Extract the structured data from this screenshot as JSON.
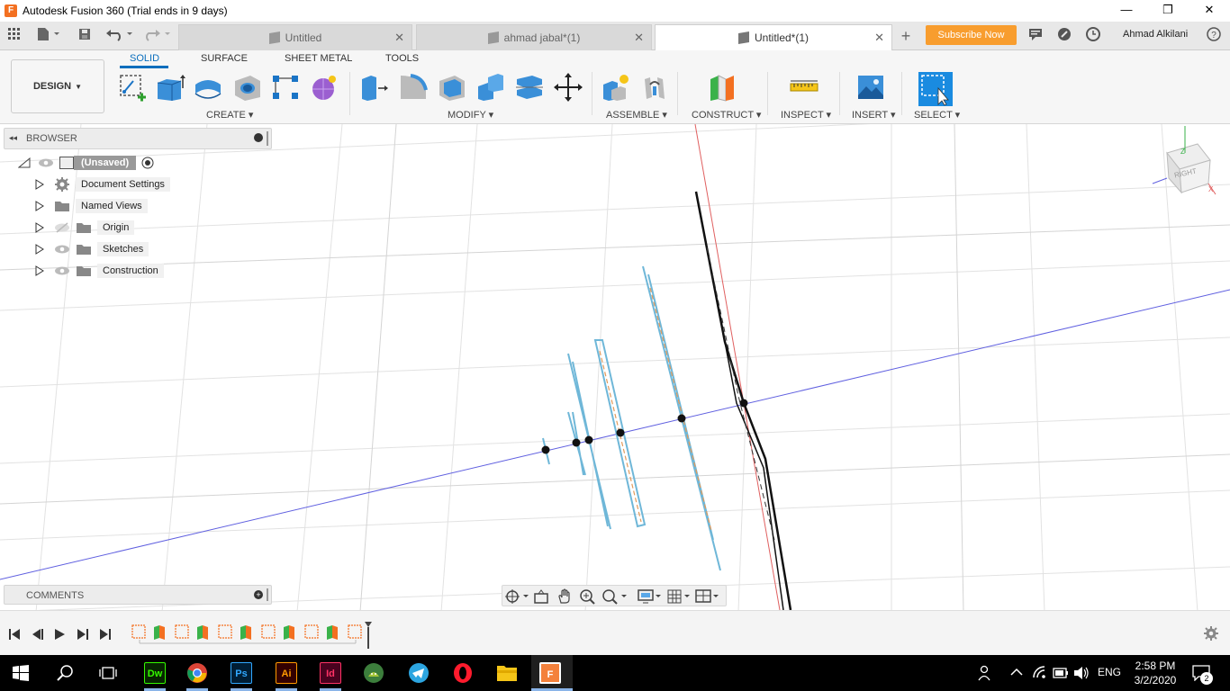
{
  "window": {
    "title": "Autodesk Fusion 360 (Trial ends in 9 days)",
    "minimize": "—",
    "maximize": "❐",
    "close": "✕"
  },
  "tabs": [
    {
      "label": "Untitled",
      "active": false
    },
    {
      "label": "ahmad jabal*(1)",
      "active": false
    },
    {
      "label": "Untitled*(1)",
      "active": true
    }
  ],
  "header": {
    "new_tab": "+",
    "subscribe": "Subscribe Now",
    "user": "Ahmad Alkilani"
  },
  "ribbon": {
    "workspace": "DESIGN",
    "tabs": [
      "SOLID",
      "SURFACE",
      "SHEET METAL",
      "TOOLS"
    ],
    "groups": {
      "create": "CREATE ▾",
      "modify": "MODIFY ▾",
      "assemble": "ASSEMBLE ▾",
      "construct": "CONSTRUCT ▾",
      "inspect": "INSPECT ▾",
      "insert": "INSERT ▾",
      "select": "SELECT ▾"
    }
  },
  "browser": {
    "title": "BROWSER",
    "root": "(Unsaved)",
    "items": [
      "Document Settings",
      "Named Views",
      "Origin",
      "Sketches",
      "Construction"
    ]
  },
  "comments": {
    "title": "COMMENTS"
  },
  "viewcube": {
    "face": "RIGHT",
    "axis_z": "Z",
    "axis_x": "X"
  },
  "taskbar": {
    "apps": [
      "Dw",
      "Ps",
      "Ai",
      "Id"
    ],
    "fusion_icon": "F",
    "language": "ENG",
    "time": "2:58 PM",
    "date": "3/2/2020",
    "notifications": "2"
  },
  "colors": {
    "accent": "#0a6ebd",
    "subscribe": "#f89d2e",
    "sketch_blue": "#6fb7d8",
    "sketch_black": "#111111",
    "axis_red": "#e05050",
    "axis_blue": "#5a5ae0"
  }
}
